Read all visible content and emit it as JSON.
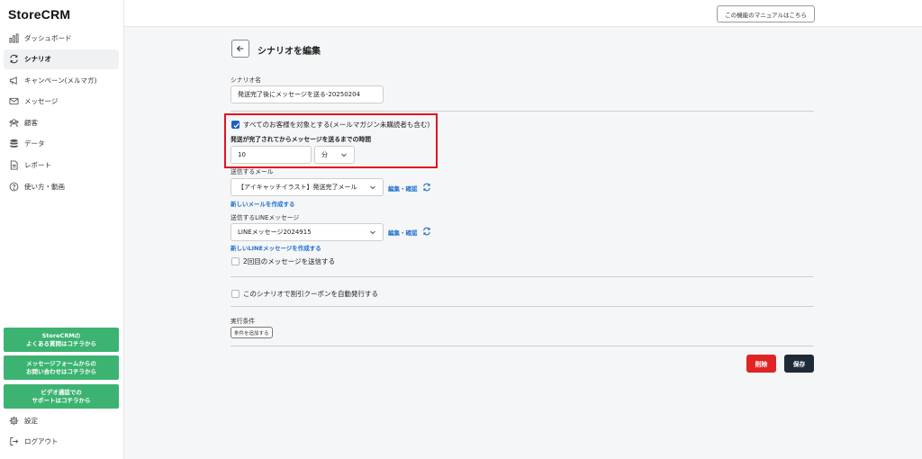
{
  "brand": "StoreCRM",
  "sidebar": {
    "items": [
      {
        "label": "ダッシュボード",
        "icon": "bar-chart-icon"
      },
      {
        "label": "シナリオ",
        "icon": "refresh-cycle-icon",
        "active": true
      },
      {
        "label": "キャンペーン(メルマガ)",
        "icon": "megaphone-icon"
      },
      {
        "label": "メッセージ",
        "icon": "mail-icon"
      },
      {
        "label": "顧客",
        "icon": "users-icon"
      },
      {
        "label": "データ",
        "icon": "database-icon"
      },
      {
        "label": "レポート",
        "icon": "document-icon"
      },
      {
        "label": "使い方・動画",
        "icon": "help-circle-icon"
      }
    ],
    "help_buttons": [
      {
        "line1": "StoreCRMの",
        "line2": "よくある質問はコチラから"
      },
      {
        "line1": "メッセージフォームからの",
        "line2": "お問い合わせはコチラから"
      },
      {
        "line1": "ビデオ通話での",
        "line2": "サポートはコチラから"
      }
    ],
    "bottom_items": [
      {
        "label": "設定",
        "icon": "gear-icon"
      },
      {
        "label": "ログアウト",
        "icon": "logout-icon"
      }
    ]
  },
  "topbar": {
    "manual_button": "この機能のマニュアルはこちら"
  },
  "form": {
    "page_title": "シナリオを編集",
    "scenario_name_label": "シナリオ名",
    "scenario_name_value": "発送完了後にメッセージを送る-20250204",
    "target_all_label": "すべてのお客様を対象とする(メールマガジン未購読者も含む)",
    "target_all_checked": true,
    "delay_label": "発送が完了されてからメッセージを送るまでの時間",
    "delay_value": "10",
    "delay_unit": "分",
    "email_label": "送信するメール",
    "email_value": "【アイキャッチイラスト】発送完了メール",
    "email_edit_link": "編集・確認",
    "new_email_link": "新しいメールを作成する",
    "line_label": "送信するLINEメッセージ",
    "line_value": "LINEメッセージ2024915",
    "line_edit_link": "編集・確認",
    "new_line_link": "新しいLINEメッセージを作成する",
    "second_message_label": "2回目のメッセージを送信する",
    "second_message_checked": false,
    "coupon_label": "このシナリオで割引クーポンを自動発行する",
    "coupon_checked": false,
    "conditions_label": "実行条件",
    "add_condition_button": "条件を追加する",
    "delete_button": "削除",
    "save_button": "保存"
  },
  "colors": {
    "accent_green": "#3cb371",
    "link_blue": "#1d6fd1",
    "delete_red": "#e02424",
    "save_dark": "#1f2a37",
    "highlight_red": "#e0131f"
  }
}
